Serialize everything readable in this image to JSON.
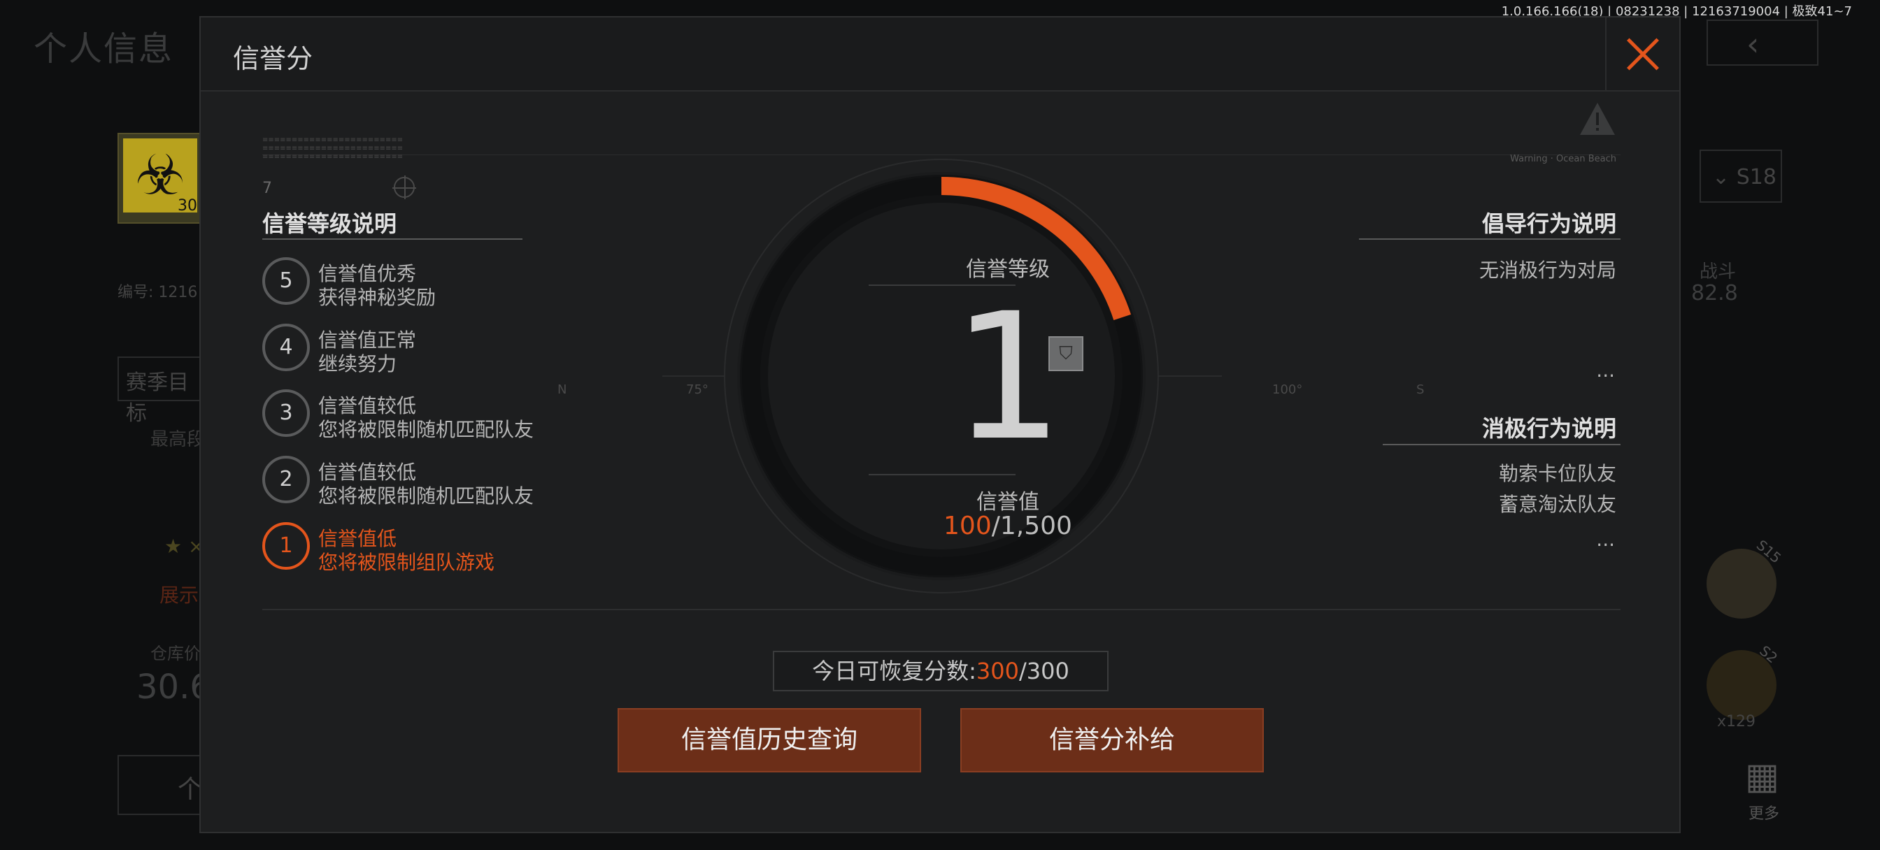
{
  "version": "1.0.166.166(18) | 08231238 | 12163719004 | 极致41~7",
  "background": {
    "page_title": "个人信息",
    "left_id_label": "编号: 1216",
    "left_section": "赛季目标",
    "left_highest": "最高段",
    "left_star": "★ ×",
    "left_show": "展示",
    "left_warehouse_label": "仓库价",
    "left_warehouse_value": "30.6",
    "left_badge_level": "30",
    "left_bottom": "个",
    "right_season": "S18",
    "right_stat_label": "战斗",
    "right_stat_value": "82.8",
    "right_badge1": "S15",
    "right_badge2": "S2",
    "right_count": "x129",
    "right_more": "更多"
  },
  "modal": {
    "title": "信誉分",
    "close_icon": "close-icon",
    "level_section_title": "信誉等级说明",
    "levels": [
      {
        "num": "5",
        "line1": "信誉值优秀",
        "line2": "获得神秘奖励"
      },
      {
        "num": "4",
        "line1": "信誉值正常",
        "line2": "继续努力"
      },
      {
        "num": "3",
        "line1": "信誉值较低",
        "line2": "您将被限制随机匹配队友"
      },
      {
        "num": "2",
        "line1": "信誉值较低",
        "line2": "您将被限制随机匹配队友"
      },
      {
        "num": "1",
        "line1": "信誉值低",
        "line2": "您将被限制组队游戏"
      }
    ],
    "current_level_index": 4,
    "gauge": {
      "label": "信誉等级",
      "level": "1",
      "value_label": "信誉值",
      "value_current": "100",
      "value_max": "/1,500",
      "fraction": 0.2
    },
    "advocate_title": "倡导行为说明",
    "advocate_items": [
      "无消极行为对局"
    ],
    "advocate_more": "...",
    "negative_title": "消极行为说明",
    "negative_items": [
      "勒索卡位队友",
      "蓄意淘汰队友"
    ],
    "negative_more": "...",
    "compass": [
      "N",
      "75°",
      "100°",
      "S"
    ],
    "decor_seven": "7",
    "decor_small_right": "Warning · Ocean Beach",
    "recover_label": "今日可恢复分数:",
    "recover_current": "300",
    "recover_max": "/300",
    "btn_history": "信誉值历史查询",
    "btn_supply": "信誉分补给",
    "accent_color": "#e4551c"
  }
}
